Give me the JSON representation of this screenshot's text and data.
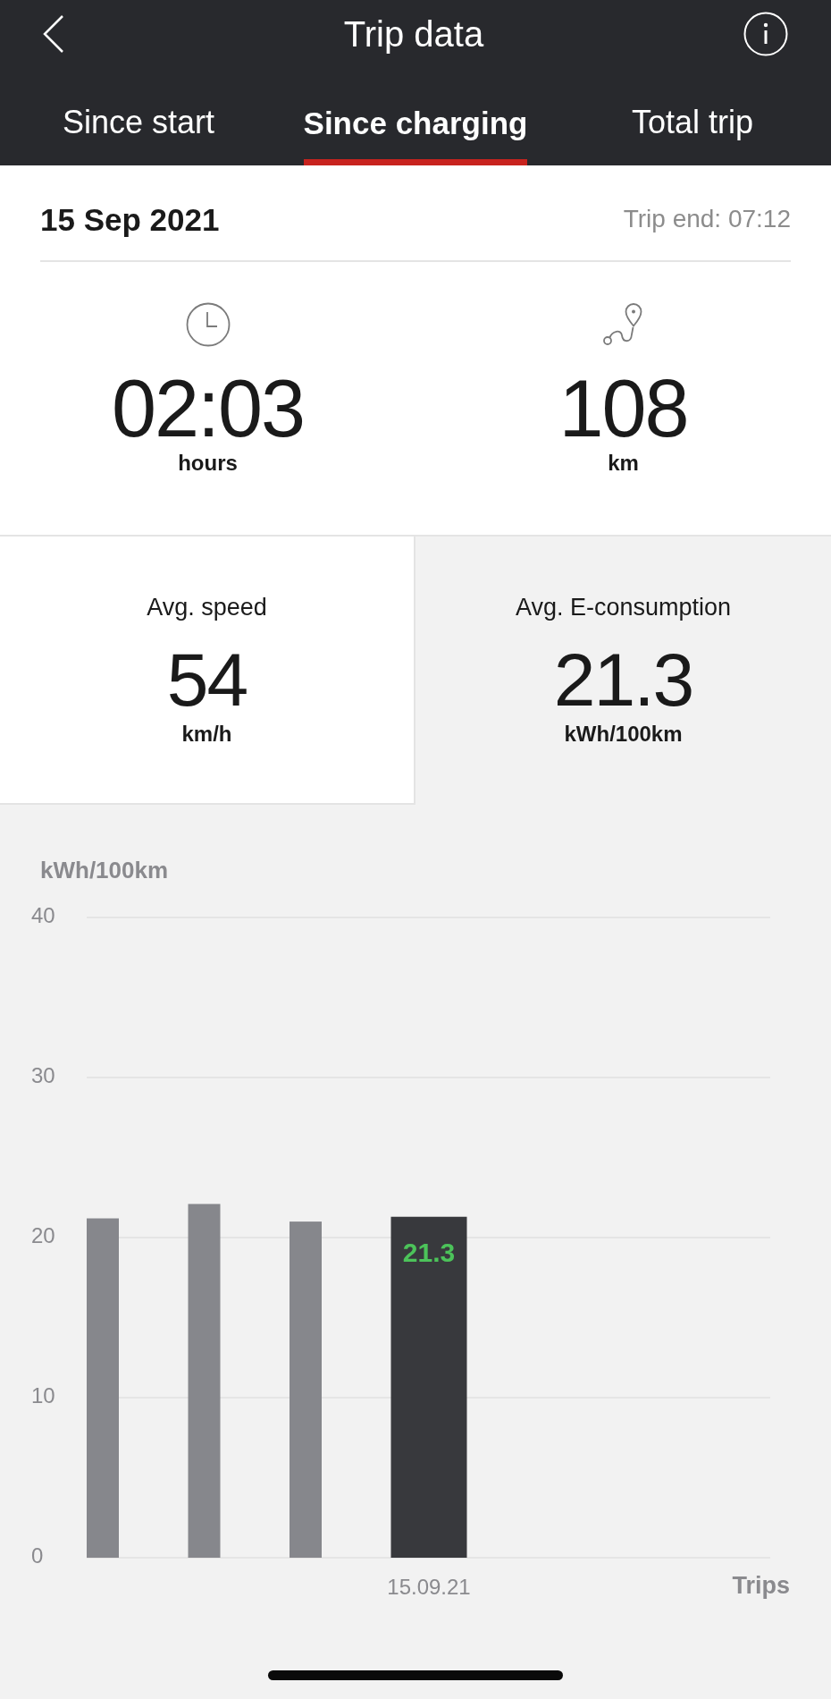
{
  "header": {
    "title": "Trip data"
  },
  "tabs": [
    {
      "label": "Since start",
      "selected": false
    },
    {
      "label": "Since charging",
      "selected": true
    },
    {
      "label": "Total trip",
      "selected": false
    }
  ],
  "summary": {
    "date": "15 Sep 2021",
    "trip_end": "Trip end: 07:12",
    "stats": [
      {
        "kind": "duration",
        "value": "02:03",
        "unit": "hours"
      },
      {
        "kind": "distance",
        "value": "108",
        "unit": "km"
      }
    ]
  },
  "averages": [
    {
      "label": "Avg. speed",
      "value": "54",
      "unit": "km/h",
      "selected": false
    },
    {
      "label": "Avg. E-consumption",
      "value": "21.3",
      "unit": "kWh/100km",
      "selected": true
    }
  ],
  "consumption_chart": {
    "chart_data": {
      "type": "bar",
      "ylabel": "kWh/100km",
      "xlabel": "Trips",
      "categories": [
        null,
        null,
        null,
        "15.09.21",
        null,
        null,
        null
      ],
      "series": [
        {
          "color": "#86878c",
          "values": [
            21.2,
            22.1,
            21.0,
            null,
            null,
            null,
            null
          ]
        },
        {
          "color": "#38393d",
          "values": [
            null,
            null,
            null,
            21.3,
            null,
            null,
            null
          ]
        }
      ],
      "ylim": [
        0,
        40
      ],
      "yticks": [
        0,
        10,
        20,
        30,
        40
      ],
      "grid": true,
      "value_labels": [
        null,
        null,
        null,
        "21.3",
        null,
        null,
        null
      ]
    }
  }
}
